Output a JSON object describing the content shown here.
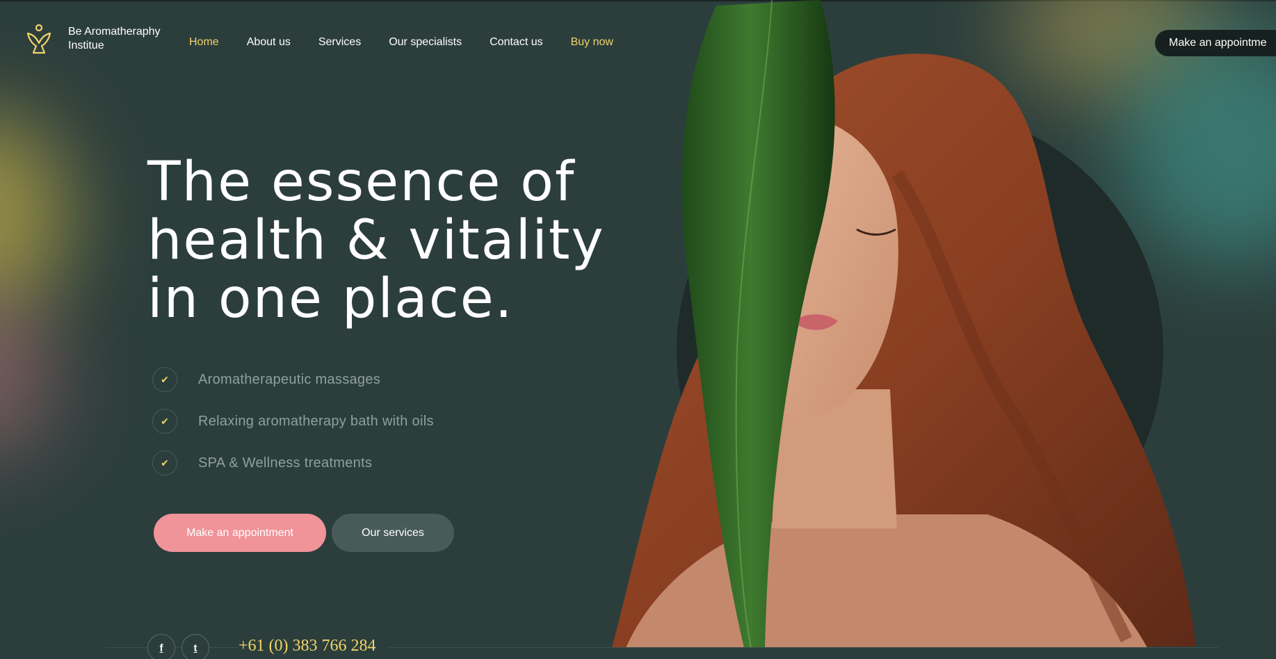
{
  "brand": {
    "name": "Be Aromatheraphy Institue",
    "logo_icon": "figure-logo-icon",
    "accent_color": "#f0d46b"
  },
  "nav": {
    "items": [
      {
        "label": "Home",
        "state": "active"
      },
      {
        "label": "About us"
      },
      {
        "label": "Services"
      },
      {
        "label": "Our specialists"
      },
      {
        "label": "Contact us"
      },
      {
        "label": "Buy now",
        "state": "highlight"
      }
    ],
    "cta_label": "Make an appointme"
  },
  "hero": {
    "headline": "The essence of health & vitality in one place.",
    "features": [
      {
        "icon": "check-icon",
        "label": "Aromatherapeutic massages"
      },
      {
        "icon": "check-icon",
        "label": "Relaxing aromatherapy bath with oils"
      },
      {
        "icon": "check-icon",
        "label": "SPA & Wellness treatments"
      }
    ],
    "primary_button": "Make an appointment",
    "secondary_button": "Our services",
    "primary_color": "#f0949a",
    "secondary_color": "#485b58",
    "image_icon": "woman-with-leaf-image"
  },
  "footer": {
    "social": [
      {
        "icon": "facebook-icon",
        "glyph": "f"
      },
      {
        "icon": "twitter-icon",
        "glyph": "t"
      }
    ],
    "phone": "+61 (0) 383 766 284"
  },
  "colors": {
    "background": "#2c3e3c",
    "circle": "#1e2b29"
  }
}
